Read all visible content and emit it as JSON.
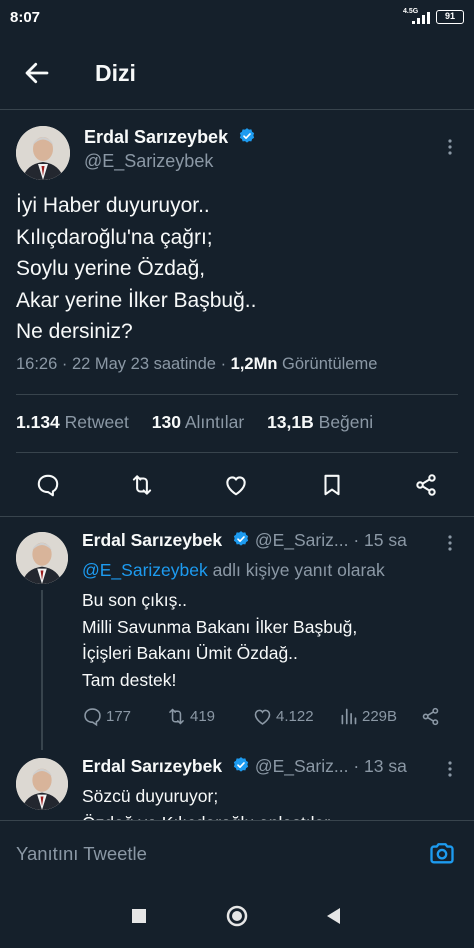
{
  "status_bar": {
    "time": "8:07",
    "network": "4.5G",
    "battery": "91"
  },
  "header": {
    "title": "Dizi",
    "back_icon": "arrow-left-icon"
  },
  "main_tweet": {
    "author_name": "Erdal Sarızeybek",
    "author_handle": "@E_Sarizeybek",
    "text": "İyi Haber duyuruyor..\nKılıçdaroğlu'na çağrı;\nSoylu yerine Özdağ,\nAkar yerine İlker Başbuğ..\nNe dersiniz?",
    "timestamp": "16:26 · 22 May 23 saatinde",
    "views_count": "1,2Mn",
    "views_label": "Görüntüleme",
    "retweets_count": "1.134",
    "retweets_label": "Retweet",
    "quotes_count": "130",
    "quotes_label": "Alıntılar",
    "likes_count": "13,1B",
    "likes_label": "Beğeni"
  },
  "replies": [
    {
      "author_name": "Erdal Sarızeybek",
      "author_handle": "@E_Sariz...",
      "age": "15 sa",
      "reply_to_mention": "@E_Sarizeybek",
      "reply_to_suffix": "adlı kişiye yanıt olarak",
      "text": "Bu son çıkış..\nMilli Savunma Bakanı İlker Başbuğ,\nİçişleri Bakanı Ümit Özdağ..\nTam destek!",
      "replies_count": "177",
      "retweets_count": "419",
      "likes_count": "4.122",
      "views_count": "229B"
    },
    {
      "author_name": "Erdal Sarızeybek",
      "author_handle": "@E_Sariz...",
      "age": "13 sa",
      "text": "Sözcü duyuruyor;\nÖzdağ ve Kılıçdaroğlu anlaştılar"
    }
  ],
  "compose": {
    "placeholder": "Yanıtını Tweetle"
  },
  "colors": {
    "background": "#15202b",
    "accent": "#1d9bf0",
    "secondary_text": "#8b98a5",
    "divider": "#38444d"
  }
}
